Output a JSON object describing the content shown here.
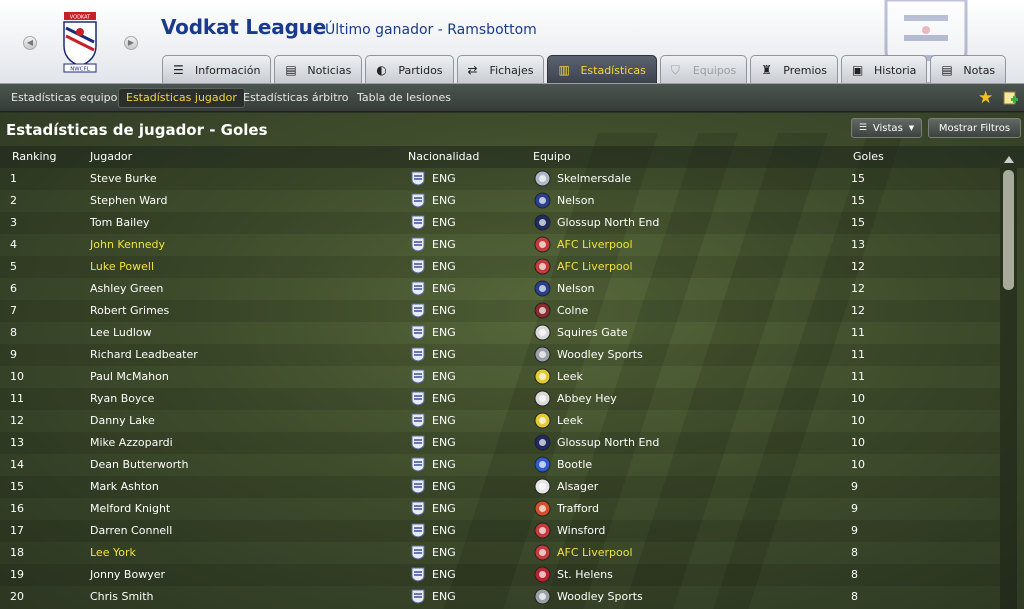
{
  "header": {
    "title": "Vodkat League",
    "subtitle": "Último ganador - Ramsbottom",
    "crest_text_top": "VODKAT",
    "crest_text_bottom": "NWCFL"
  },
  "tabs": [
    {
      "label": "Información",
      "icon": "list-icon",
      "state": "normal"
    },
    {
      "label": "Noticias",
      "icon": "newspaper-icon",
      "state": "normal"
    },
    {
      "label": "Partidos",
      "icon": "fixtures-icon",
      "state": "normal"
    },
    {
      "label": "Fichajes",
      "icon": "transfer-arrows-icon",
      "state": "normal"
    },
    {
      "label": "Estadísticas",
      "icon": "stats-bars-icon",
      "state": "active"
    },
    {
      "label": "Equipos",
      "icon": "shield-icon",
      "state": "disabled"
    },
    {
      "label": "Premios",
      "icon": "trophy-icon",
      "state": "normal"
    },
    {
      "label": "Historia",
      "icon": "book-icon",
      "state": "normal"
    },
    {
      "label": "Notas",
      "icon": "note-icon",
      "state": "normal"
    }
  ],
  "subnav": {
    "items": [
      "Estadísticas equipo",
      "Estadísticas jugador",
      "Estadísticas árbitro",
      "Tabla de lesiones"
    ],
    "active": "Estadísticas jugador"
  },
  "section": {
    "title": "Estadísticas de jugador - Goles",
    "views_label": "Vistas",
    "filters_label": "Mostrar Filtros"
  },
  "table": {
    "columns": [
      "Ranking",
      "Jugador",
      "Nacionalidad",
      "Equipo",
      "Goles"
    ],
    "rows": [
      {
        "rank": "1",
        "player": "Steve Burke",
        "nat": "ENG",
        "club": "Skelmersdale",
        "goals": "15",
        "hl": false,
        "color": "#b0b8c8"
      },
      {
        "rank": "2",
        "player": "Stephen Ward",
        "nat": "ENG",
        "club": "Nelson",
        "goals": "15",
        "hl": false,
        "color": "#2b3f8f"
      },
      {
        "rank": "3",
        "player": "Tom Bailey",
        "nat": "ENG",
        "club": "Glossup North End",
        "goals": "15",
        "hl": false,
        "color": "#1f2a60"
      },
      {
        "rank": "4",
        "player": "John Kennedy",
        "nat": "ENG",
        "club": "AFC Liverpool",
        "goals": "13",
        "hl": true,
        "color": "#c43b3b"
      },
      {
        "rank": "5",
        "player": "Luke Powell",
        "nat": "ENG",
        "club": "AFC Liverpool",
        "goals": "12",
        "hl": true,
        "color": "#c43b3b"
      },
      {
        "rank": "6",
        "player": "Ashley Green",
        "nat": "ENG",
        "club": "Nelson",
        "goals": "12",
        "hl": false,
        "color": "#2b3f8f"
      },
      {
        "rank": "7",
        "player": "Robert Grimes",
        "nat": "ENG",
        "club": "Colne",
        "goals": "12",
        "hl": false,
        "color": "#8b2a2a"
      },
      {
        "rank": "8",
        "player": "Lee Ludlow",
        "nat": "ENG",
        "club": "Squires Gate",
        "goals": "11",
        "hl": false,
        "color": "#d9d9d9"
      },
      {
        "rank": "9",
        "player": "Richard Leadbeater",
        "nat": "ENG",
        "club": "Woodley Sports",
        "goals": "11",
        "hl": false,
        "color": "#9aa0a6"
      },
      {
        "rank": "10",
        "player": "Paul McMahon",
        "nat": "ENG",
        "club": "Leek",
        "goals": "11",
        "hl": false,
        "color": "#e3c83a"
      },
      {
        "rank": "11",
        "player": "Ryan Boyce",
        "nat": "ENG",
        "club": "Abbey Hey",
        "goals": "10",
        "hl": false,
        "color": "#d9d9d9"
      },
      {
        "rank": "12",
        "player": "Danny Lake",
        "nat": "ENG",
        "club": "Leek",
        "goals": "10",
        "hl": false,
        "color": "#e3c83a"
      },
      {
        "rank": "13",
        "player": "Mike Azzopardi",
        "nat": "ENG",
        "club": "Glossup North End",
        "goals": "10",
        "hl": false,
        "color": "#1f2a60"
      },
      {
        "rank": "14",
        "player": "Dean Butterworth",
        "nat": "ENG",
        "club": "Bootle",
        "goals": "10",
        "hl": false,
        "color": "#2f5bd1"
      },
      {
        "rank": "15",
        "player": "Mark Ashton",
        "nat": "ENG",
        "club": "Alsager",
        "goals": "9",
        "hl": false,
        "color": "#e6e6e6"
      },
      {
        "rank": "16",
        "player": "Melford Knight",
        "nat": "ENG",
        "club": "Trafford",
        "goals": "9",
        "hl": false,
        "color": "#d4502a"
      },
      {
        "rank": "17",
        "player": "Darren Connell",
        "nat": "ENG",
        "club": "Winsford",
        "goals": "9",
        "hl": false,
        "color": "#c43b3b"
      },
      {
        "rank": "18",
        "player": "Lee York",
        "nat": "ENG",
        "club": "AFC Liverpool",
        "goals": "8",
        "hl": true,
        "color": "#c43b3b"
      },
      {
        "rank": "19",
        "player": "Jonny Bowyer",
        "nat": "ENG",
        "club": "St. Helens",
        "goals": "8",
        "hl": false,
        "color": "#b5252f"
      },
      {
        "rank": "20",
        "player": "Chris Smith",
        "nat": "ENG",
        "club": "Woodley Sports",
        "goals": "8",
        "hl": false,
        "color": "#9aa0a6"
      }
    ]
  },
  "colors": {
    "accent_yellow": "#f2d63a",
    "title_blue": "#1a3a8a",
    "pitch_green": "#4a5a33"
  }
}
